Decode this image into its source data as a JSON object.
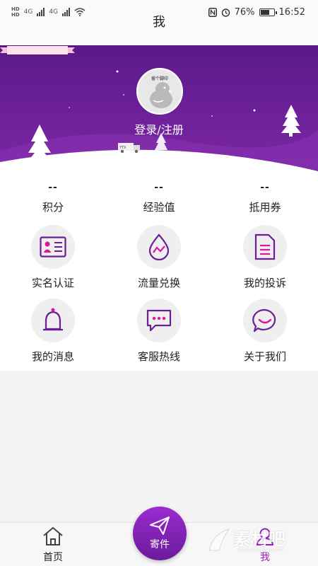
{
  "status_bar": {
    "hd1": "HD",
    "hd2": "HD",
    "net1": "4G",
    "net2": "4G",
    "battery_percent_text": "76%",
    "battery_level": 0.76,
    "time": "16:52"
  },
  "header": {
    "title": "我"
  },
  "profile": {
    "login_label": "登录/注册",
    "avatar_badge_text": "留个脚印"
  },
  "stats": [
    {
      "value": "--",
      "label": "积分"
    },
    {
      "value": "--",
      "label": "经验值"
    },
    {
      "value": "--",
      "label": "抵用券"
    }
  ],
  "menu": [
    {
      "label": "实名认证",
      "icon": "id-card-icon"
    },
    {
      "label": "流量兑换",
      "icon": "data-drop-icon"
    },
    {
      "label": "我的投诉",
      "icon": "document-icon"
    },
    {
      "label": "我的消息",
      "icon": "bell-icon"
    },
    {
      "label": "客服热线",
      "icon": "chat-bubble-icon"
    },
    {
      "label": "关于我们",
      "icon": "smile-bubble-icon"
    }
  ],
  "tabbar": {
    "home_label": "首页",
    "send_label": "寄件",
    "me_label": "我"
  },
  "watermark": {
    "text": "素材吧",
    "url": "www.sucaibar.com"
  },
  "colors": {
    "primary": "#6a1f96",
    "accent": "#e0159f",
    "active_tab": "#9b1fc0"
  }
}
